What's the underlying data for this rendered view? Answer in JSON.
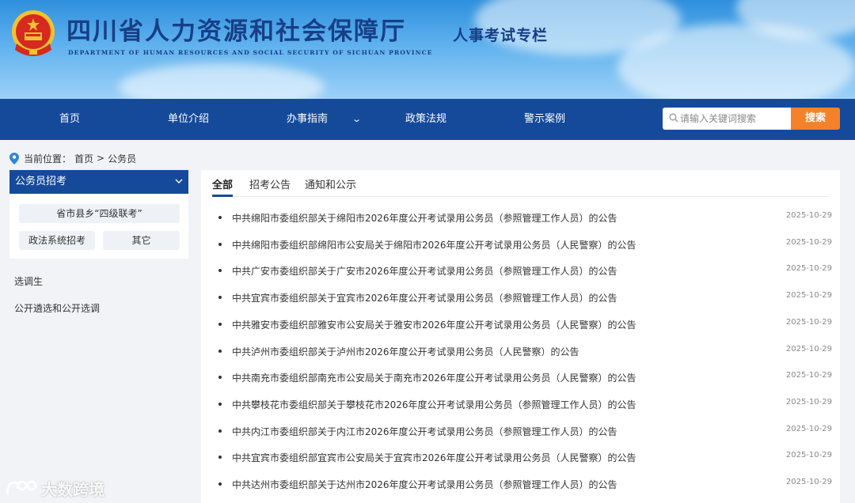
{
  "header": {
    "title": "四川省人力资源和社会保障厅",
    "subtitle": "DEPARTMENT OF HUMAN RESOURCES AND SOCIAL SECURITY OF SICHUAN PROVINCE",
    "column": "人事考试专栏"
  },
  "nav": {
    "items": [
      {
        "label": "首页"
      },
      {
        "label": "单位介绍"
      },
      {
        "label": "办事指南"
      },
      {
        "label": "政策法规"
      },
      {
        "label": "警示案例"
      }
    ],
    "search_placeholder": "请输入关键词搜索",
    "search_button": "搜索"
  },
  "breadcrumb": {
    "prefix": "当前位置：",
    "home": "首页",
    "separator": ">",
    "current": "公务员"
  },
  "sidebar": {
    "header": "公务员招考",
    "tags": [
      "省市县乡“四级联考”",
      "政法系统招考",
      "其它"
    ],
    "links": [
      "选调生",
      "公开遴选和公开选调"
    ]
  },
  "tabs": [
    "全部",
    "招考公告",
    "通知和公示"
  ],
  "articles": [
    {
      "title": "中共绵阳市委组织部关于绵阳市2026年度公开考试录用公务员（参照管理工作人员）的公告",
      "date": "2025-10-29"
    },
    {
      "title": "中共绵阳市委组织部绵阳市公安局关于绵阳市2026年度公开考试录用公务员（人民警察）的公告",
      "date": "2025-10-29"
    },
    {
      "title": "中共广安市委组织部关于广安市2026年度公开考试录用公务员（参照管理工作人员）的公告",
      "date": "2025-10-29"
    },
    {
      "title": "中共宜宾市委组织部关于宜宾市2026年度公开考试录用公务员（参照管理工作人员）的公告",
      "date": "2025-10-29"
    },
    {
      "title": "中共雅安市委组织部雅安市公安局关于雅安市2026年度公开考试录用公务员（人民警察）的公告",
      "date": "2025-10-29"
    },
    {
      "title": "中共泸州市委组织部关于泸州市2026年度公开考试录用公务员（人民警察）的公告",
      "date": "2025-10-29"
    },
    {
      "title": "中共南充市委组织部南充市公安局关于南充市2026年度公开考试录用公务员（人民警察）的公告",
      "date": "2025-10-29"
    },
    {
      "title": "中共攀枝花市委组织部关于攀枝花市2026年度公开考试录用公务员（参照管理工作人员）的公告",
      "date": "2025-10-29"
    },
    {
      "title": "中共内江市委组织部关于内江市2026年度公开考试录用公务员（参照管理工作人员）的公告",
      "date": "2025-10-29"
    },
    {
      "title": "中共宜宾市委组织部宜宾市公安局关于宜宾市2026年度公开考试录用公务员（人民警察）的公告",
      "date": "2025-10-29"
    },
    {
      "title": "中共达州市委组织部关于达州市2026年度公开考试录用公务员（参照管理工作人员）的公告",
      "date": "2025-10-29"
    }
  ],
  "watermark": "大数跨境",
  "colors": {
    "nav": "#154a9b",
    "accent": "#f5822a",
    "title": "#173f86"
  }
}
